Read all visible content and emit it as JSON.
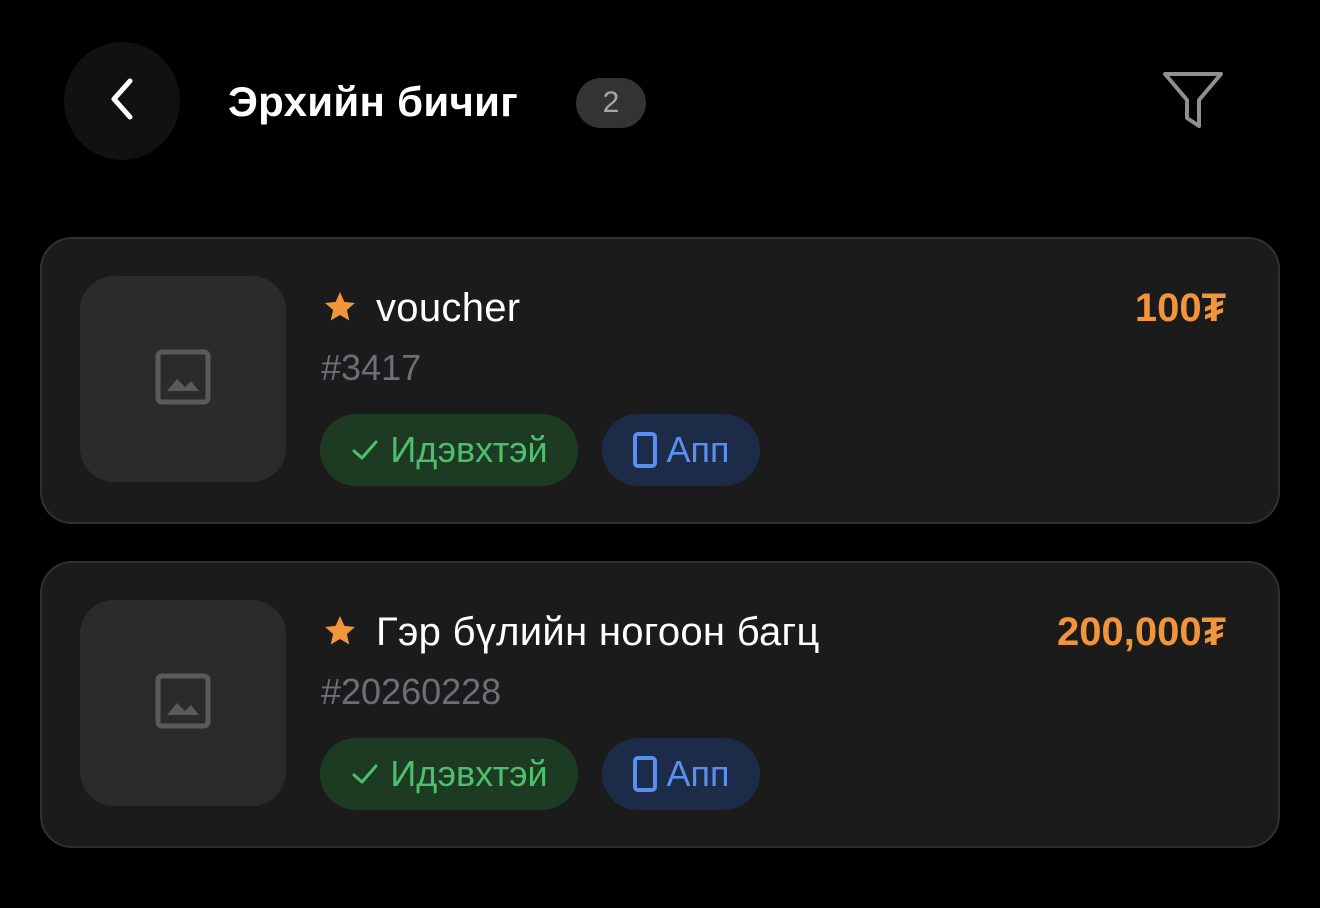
{
  "header": {
    "title": "Эрхийн бичиг",
    "count": "2",
    "back_icon": "chevron-left-icon",
    "filter_icon": "filter-icon"
  },
  "colors": {
    "background": "#000000",
    "card": "#1b1b1b",
    "price": "#f0953a",
    "star": "#f0953a",
    "active_text": "#4cc06c",
    "active_bg": "#1d3a23",
    "app_text": "#5a8ef0",
    "app_bg": "#1c2b48"
  },
  "vouchers": [
    {
      "name": "voucher",
      "id": "#3417",
      "price": "100₮",
      "status": "Идэвхтэй",
      "channel": "Апп",
      "favorite": true,
      "thumbnail_icon": "image-placeholder-icon"
    },
    {
      "name": "Гэр бүлийн ногоон багц",
      "id": "#20260228",
      "price": "200,000₮",
      "status": "Идэвхтэй",
      "channel": "Апп",
      "favorite": true,
      "thumbnail_icon": "image-placeholder-icon"
    }
  ]
}
